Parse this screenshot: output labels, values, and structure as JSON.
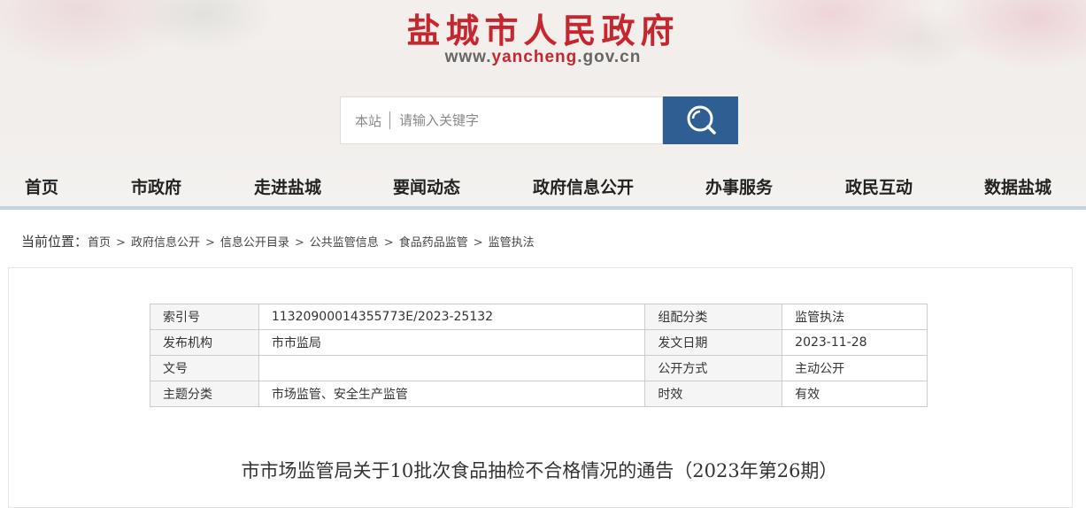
{
  "header": {
    "site_title": "盐城市人民政府",
    "domain_prefix": "www.",
    "domain_mid": "yancheng",
    "domain_suffix": ".gov.cn",
    "search": {
      "scope": "本站",
      "placeholder": "请输入关键字",
      "button_icon": "search-icon"
    },
    "accent_color": "#c6262e",
    "search_button_color": "#2f5f92"
  },
  "nav": {
    "items": [
      {
        "label": "首页"
      },
      {
        "label": "市政府"
      },
      {
        "label": "走进盐城"
      },
      {
        "label": "要闻动态"
      },
      {
        "label": "政府信息公开"
      },
      {
        "label": "办事服务"
      },
      {
        "label": "政民互动"
      },
      {
        "label": "数据盐城"
      }
    ]
  },
  "breadcrumb": {
    "lead": "当前位置：",
    "items": [
      "首页",
      "政府信息公开",
      "信息公开目录",
      "公共监管信息",
      "食品药品监管",
      "监管执法"
    ],
    "separator": ">"
  },
  "meta_table": {
    "rows": [
      {
        "l1": "索引号",
        "v1": "11320900014355773E/2023-25132",
        "l2": "组配分类",
        "v2": "监管执法"
      },
      {
        "l1": "发布机构",
        "v1": "市市监局",
        "l2": "发文日期",
        "v2": "2023-11-28"
      },
      {
        "l1": "文号",
        "v1": "",
        "l2": "公开方式",
        "v2": "主动公开"
      },
      {
        "l1": "主题分类",
        "v1": "市场监管、安全生产监管",
        "l2": "时效",
        "v2": "有效"
      }
    ]
  },
  "document": {
    "title": "市市场监管局关于10批次食品抽检不合格情况的通告（2023年第26期）"
  }
}
